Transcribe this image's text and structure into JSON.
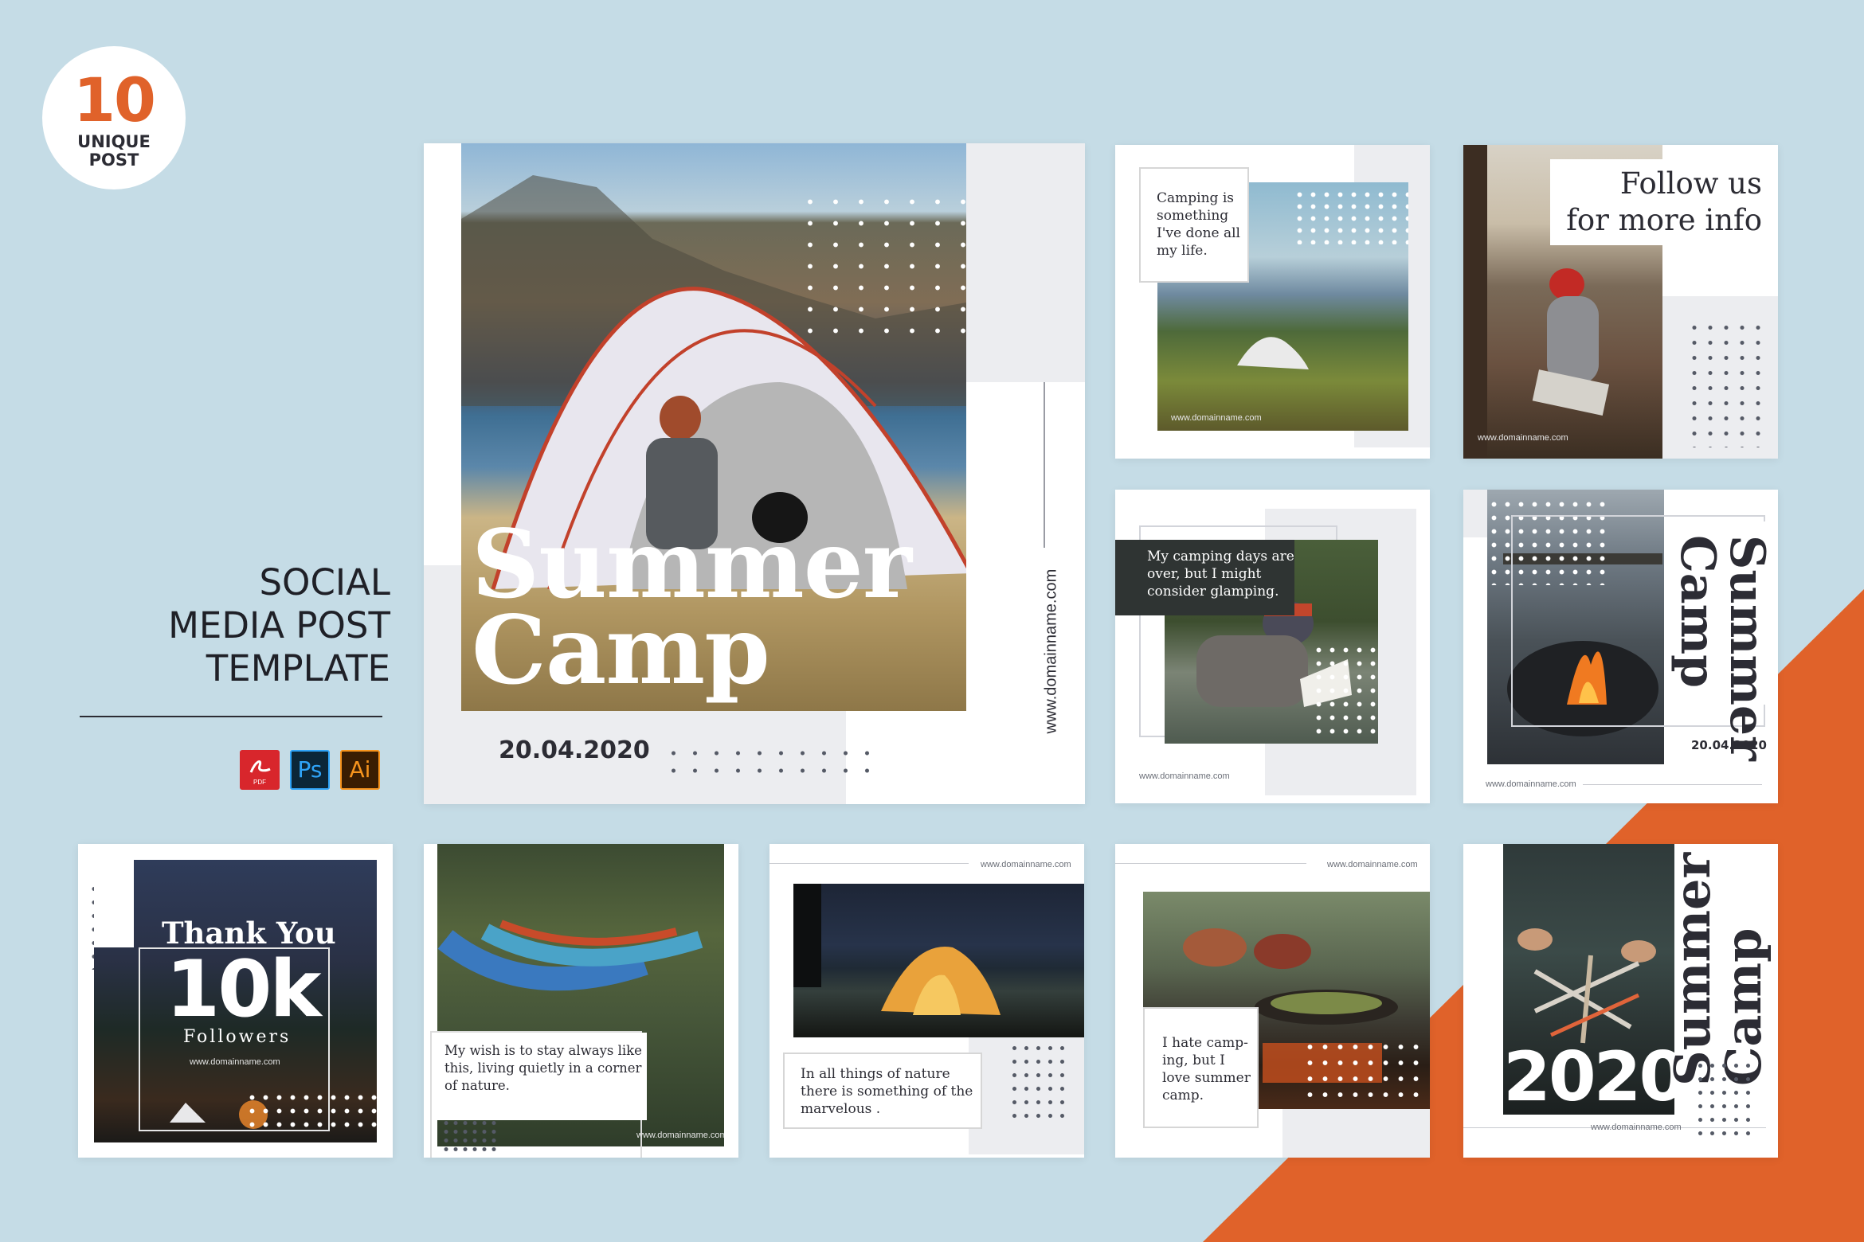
{
  "badge": {
    "number": "10",
    "line1": "UNIQUE",
    "line2": "POST"
  },
  "heading": {
    "line1": "SOCIAL",
    "line2": "MEDIA POST",
    "line3": "TEMPLATE"
  },
  "app_icons": [
    {
      "name": "pdf-icon",
      "label": "",
      "sub": "PDF"
    },
    {
      "name": "photoshop-icon",
      "label": "Ps"
    },
    {
      "name": "illustrator-icon",
      "label": "Ai"
    }
  ],
  "colors": {
    "background": "#c5dce6",
    "accent": "#e0622a",
    "text_dark": "#2c2c34"
  },
  "posts": {
    "main": {
      "title1": "Summer",
      "title2": "Camp",
      "date": "20.04.2020",
      "url": "www.domainname.com"
    },
    "p2": {
      "quote": "Camping is something I've done all my life.",
      "url": "www.domainname.com"
    },
    "p3": {
      "title1": "Follow us",
      "title2": "for more info",
      "url": "www.domainname.com"
    },
    "p4": {
      "quote": "My camping days are over, but I might consider glamping.",
      "url": "www.domainname.com"
    },
    "p5": {
      "title1": "Summer",
      "title2": "Camp",
      "date": "20.04.2020",
      "url": "www.domainname.com"
    },
    "p6": {
      "line1": "Thank You",
      "line2": "10k",
      "line3": "Followers",
      "url": "www.domainname.com"
    },
    "p7": {
      "quote": "My wish is to stay always like this, living quietly in a corner of nature.",
      "url": "www.domainname.com"
    },
    "p8": {
      "quote": "In all things of nature there is something of the marvelous .",
      "url": "www.domainname.com"
    },
    "p9": {
      "quote": "I hate camp-ing, but I love summer camp.",
      "url": "www.domainname.com"
    },
    "p10": {
      "title1": "Summer",
      "title2": "Camp",
      "year": "2020",
      "url": "www.domainname.com"
    }
  }
}
